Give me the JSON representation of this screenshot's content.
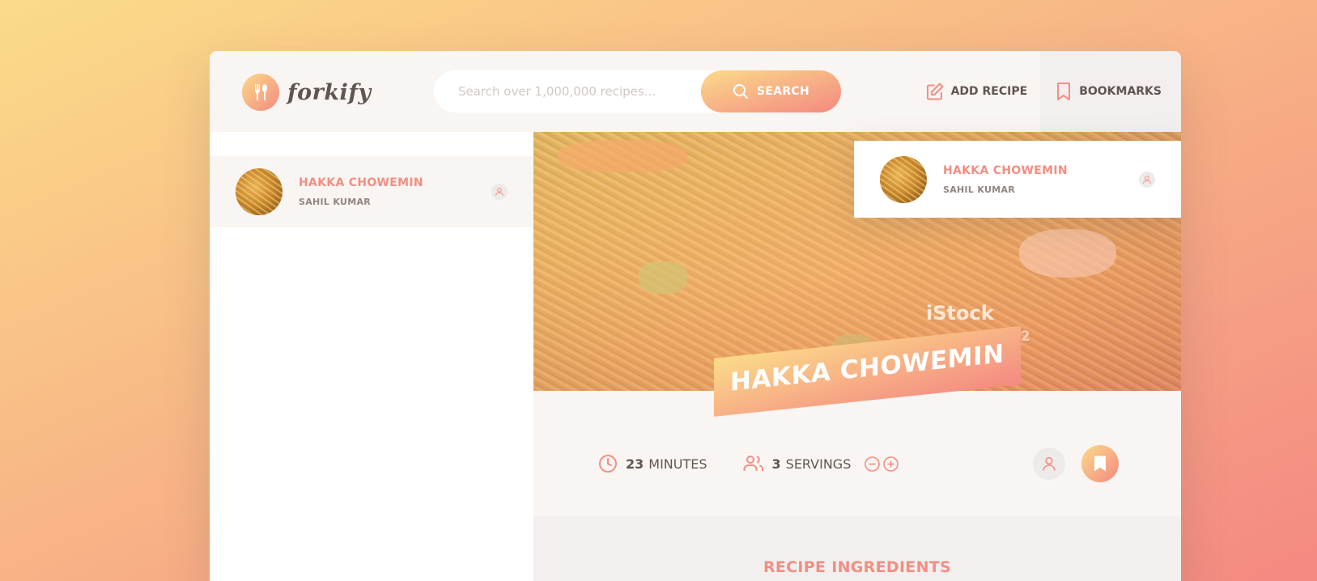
{
  "header": {
    "logo_text": "forkify",
    "search_placeholder": "Search over 1,000,000 recipes...",
    "search_button": "SEARCH",
    "nav_add_recipe": "ADD RECIPE",
    "nav_bookmarks": "BOOKMARKS"
  },
  "results": [
    {
      "title": "HAKKA CHOWEMIN",
      "publisher": "SAHIL KUMAR"
    }
  ],
  "bookmarks": [
    {
      "title": "HAKKA CHOWEMIN",
      "publisher": "SAHIL KUMAR"
    }
  ],
  "recipe": {
    "title": "HAKKA CHOWEMIN",
    "image_watermark": "iStock",
    "image_watermark_credit": "ofack2",
    "cooking_time": "23",
    "cooking_time_unit": "MINUTES",
    "servings": "3",
    "servings_unit": "SERVINGS",
    "ingredients_heading": "RECIPE INGREDIENTS"
  },
  "colors": {
    "gradient_start": "#fbdb89",
    "gradient_end": "#f48982",
    "accent": "#f38e82",
    "text": "#615551",
    "panel_bg": "#f9f5f3"
  },
  "icons": [
    "fork-knife-logo-icon",
    "search-icon",
    "edit-icon",
    "bookmark-icon",
    "user-icon",
    "clock-icon",
    "users-icon",
    "minus-circle-icon",
    "plus-circle-icon"
  ]
}
